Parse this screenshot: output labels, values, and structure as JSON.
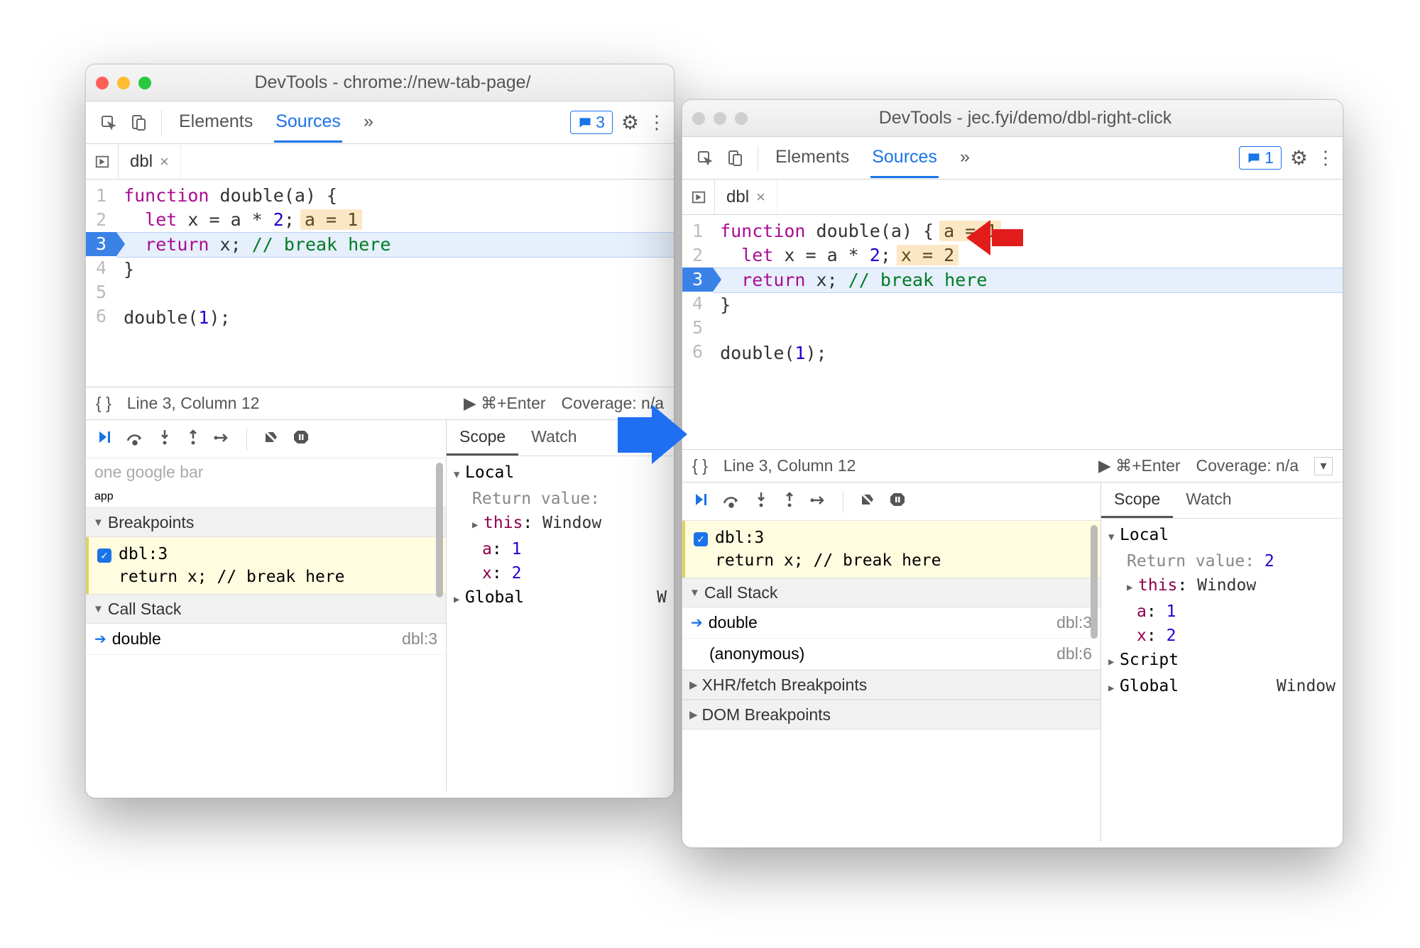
{
  "window1": {
    "title": "DevTools - chrome://new-tab-page/",
    "panels": {
      "elements": "Elements",
      "sources": "Sources",
      "more": "»"
    },
    "messages_count": "3",
    "file_tab": "dbl",
    "code": {
      "lines": [
        {
          "n": "1",
          "raw": "function double(a) {",
          "tokens": [
            [
              "kw",
              "function"
            ],
            [
              "op",
              " double(a) {"
            ]
          ]
        },
        {
          "n": "2",
          "raw": "  let x = a * 2;",
          "tokens": [
            [
              "op",
              "  "
            ],
            [
              "kw",
              "let"
            ],
            [
              "op",
              " x = a * "
            ],
            [
              "num",
              "2"
            ],
            [
              "op",
              ";"
            ]
          ],
          "inline": "a = 1"
        },
        {
          "n": "3",
          "raw": "  return x; // break here",
          "hl": true,
          "bp": true,
          "tokens": [
            [
              "op",
              "  "
            ],
            [
              "kw",
              "return"
            ],
            [
              "op",
              " x; "
            ],
            [
              "cmt",
              "// break here"
            ]
          ]
        },
        {
          "n": "4",
          "raw": "}",
          "tokens": [
            [
              "op",
              "}"
            ]
          ]
        },
        {
          "n": "5",
          "raw": "",
          "tokens": []
        },
        {
          "n": "6",
          "raw": "double(1);",
          "tokens": [
            [
              "op",
              "double("
            ],
            [
              "num",
              "1"
            ],
            [
              "op",
              ");"
            ]
          ]
        }
      ]
    },
    "status": {
      "lc": "Line 3, Column 12",
      "run": "▶ ⌘+Enter",
      "cov": "Coverage: n/a"
    },
    "debug_left": {
      "top_items": [
        "app"
      ],
      "breakpoints_label": "Breakpoints",
      "bp_item": {
        "file": "dbl:3",
        "code": "return x; // break here"
      },
      "callstack_label": "Call Stack",
      "stack": [
        {
          "fn": "double",
          "loc": "dbl:3",
          "current": true
        }
      ]
    },
    "debug_right": {
      "scope_tab": "Scope",
      "watch_tab": "Watch",
      "local_label": "Local",
      "rows": [
        {
          "label": "Return value:",
          "val": ""
        },
        {
          "key": "this",
          "obj": "Window",
          "tri": "▶"
        },
        {
          "key": "a",
          "val": "1"
        },
        {
          "key": "x",
          "val": "2"
        }
      ],
      "global_label": "Global",
      "global_obj": "W"
    }
  },
  "window2": {
    "title": "DevTools - jec.fyi/demo/dbl-right-click",
    "panels": {
      "elements": "Elements",
      "sources": "Sources",
      "more": "»"
    },
    "messages_count": "1",
    "file_tab": "dbl",
    "code": {
      "lines": [
        {
          "n": "1",
          "raw": "function double(a) {",
          "tokens": [
            [
              "kw",
              "function"
            ],
            [
              "op",
              " double(a) {"
            ]
          ],
          "inline": "a = 1"
        },
        {
          "n": "2",
          "raw": "  let x = a * 2;",
          "tokens": [
            [
              "op",
              "  "
            ],
            [
              "kw",
              "let"
            ],
            [
              "op",
              " x = a * "
            ],
            [
              "num",
              "2"
            ],
            [
              "op",
              ";"
            ]
          ],
          "inline": "x = 2"
        },
        {
          "n": "3",
          "raw": "  return x; // break here",
          "hl": true,
          "bp": true,
          "tokens": [
            [
              "op",
              "  "
            ],
            [
              "kw",
              "return"
            ],
            [
              "op",
              " x; "
            ],
            [
              "cmt",
              "// break here"
            ]
          ]
        },
        {
          "n": "4",
          "raw": "}",
          "tokens": [
            [
              "op",
              "}"
            ]
          ]
        },
        {
          "n": "5",
          "raw": "",
          "tokens": []
        },
        {
          "n": "6",
          "raw": "double(1);",
          "tokens": [
            [
              "op",
              "double("
            ],
            [
              "num",
              "1"
            ],
            [
              "op",
              ");"
            ]
          ]
        }
      ]
    },
    "status": {
      "lc": "Line 3, Column 12",
      "run": "▶ ⌘+Enter",
      "cov": "Coverage: n/a"
    },
    "debug_left": {
      "bp_item": {
        "file": "dbl:3",
        "code": "return x; // break here"
      },
      "callstack_label": "Call Stack",
      "stack": [
        {
          "fn": "double",
          "loc": "dbl:3",
          "current": true
        },
        {
          "fn": "(anonymous)",
          "loc": "dbl:6",
          "current": false
        }
      ],
      "xhr_label": "XHR/fetch Breakpoints",
      "dom_label": "DOM Breakpoints"
    },
    "debug_right": {
      "scope_tab": "Scope",
      "watch_tab": "Watch",
      "local_label": "Local",
      "rows": [
        {
          "label": "Return value:",
          "val": "2"
        },
        {
          "key": "this",
          "obj": "Window",
          "tri": "▶"
        },
        {
          "key": "a",
          "val": "1"
        },
        {
          "key": "x",
          "val": "2"
        }
      ],
      "script_label": "Script",
      "global_label": "Global",
      "global_obj": "Window"
    }
  }
}
